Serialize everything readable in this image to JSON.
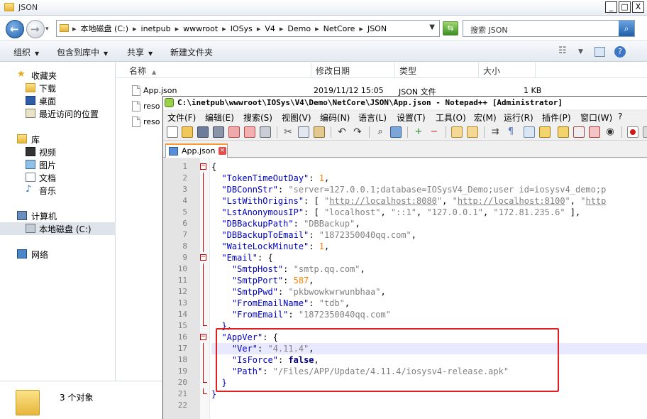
{
  "explorer": {
    "title": "JSON",
    "window_buttons": [
      "_",
      "□",
      "X"
    ],
    "address_crumbs": [
      "本地磁盘 (C:)",
      "inetpub",
      "wwwroot",
      "IOSys",
      "V4",
      "Demo",
      "NetCore",
      "JSON"
    ],
    "search_placeholder": "搜索 JSON",
    "toolbar": {
      "organize": "组织",
      "include_library": "包含到库中",
      "share": "共享",
      "new_folder": "新建文件夹"
    },
    "nav": {
      "favorites": "收藏夹",
      "downloads": "下载",
      "desktop": "桌面",
      "recent": "最近访问的位置",
      "libraries": "库",
      "videos": "视频",
      "pictures": "图片",
      "documents": "文档",
      "music": "音乐",
      "computer": "计算机",
      "local_disk": "本地磁盘 (C:)",
      "network": "网络"
    },
    "columns": [
      "名称",
      "修改日期",
      "类型",
      "大小"
    ],
    "files": [
      {
        "name": "App.json",
        "date": "2019/11/12 15:05",
        "type": "JSON 文件",
        "size": "1 KB"
      },
      {
        "name": "reso",
        "date": "",
        "type": "",
        "size": ""
      },
      {
        "name": "reso",
        "date": "",
        "type": "",
        "size": ""
      }
    ],
    "status": "3 个对象"
  },
  "npp": {
    "title": "C:\\inetpub\\wwwroot\\IOSys\\V4\\Demo\\NetCore\\JSON\\App.json - Notepad++ [Administrator]",
    "menu": [
      "文件(F)",
      "编辑(E)",
      "搜索(S)",
      "视图(V)",
      "编码(N)",
      "语言(L)",
      "设置(T)",
      "工具(O)",
      "宏(M)",
      "运行(R)",
      "插件(P)",
      "窗口(W)",
      "?"
    ],
    "tab": "App.json",
    "active_line": 17
  },
  "code": {
    "l3_value": "\"server=127.0.0.1;database=IOSysV4_Demo;user id=iosysv4_demo;p",
    "l4_url1": "http://localhost:8080",
    "l4_url2": "http://localhost:8100",
    "l4_url3": "http",
    "l5_ips": [
      "\"localhost\"",
      "\"::1\"",
      "\"127.0.0.1\"",
      "\"172.81.235.6\""
    ],
    "token_timeout": "1",
    "backup_path": "\"DBBackup\"",
    "backup_email": "\"1872350040qq.com\"",
    "wait_lock": "1",
    "smtp_host": "\"smtp.qq.com\"",
    "smtp_port": "587",
    "smtp_pwd": "\"pkbwowkwrwunbhaa\"",
    "from_name": "\"tdb\"",
    "from_email": "\"1872350040qq.com\"",
    "ver": "\"4.11.4\"",
    "is_force": "false",
    "path": "\"/Files/APP/Update/4.11.4/iosysv4-release.apk\""
  }
}
